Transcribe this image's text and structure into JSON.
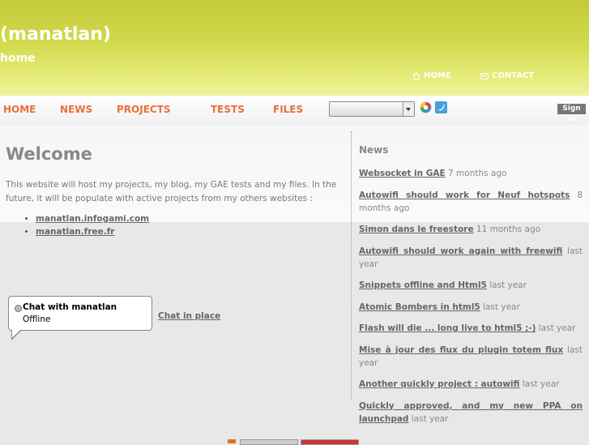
{
  "header": {
    "site_title": "(manatlan)",
    "subtitle": "home",
    "links": {
      "home": "HOME",
      "contact": "CONTACT"
    }
  },
  "nav": {
    "items": [
      "HOME",
      "NEWS",
      "PROJECTS",
      "TESTS",
      "FILES"
    ],
    "select_value": "",
    "sign_in": "Sign in",
    "icons": [
      "google-icon",
      "twitter-icon"
    ]
  },
  "main": {
    "title": "Welcome",
    "intro": "This website will host my projects, my blog, my GAE tests and my files. In the future, it will be populate with active projects from my others websites :",
    "projects": [
      "manatlan.infogami.com",
      "manatlan.free.fr"
    ]
  },
  "sidebar": {
    "title": "News",
    "news": [
      {
        "title": "Websocket in GAE",
        "time": "7 months ago"
      },
      {
        "title": "Autowifi should work for Neuf hotspots",
        "time": "8 months ago"
      },
      {
        "title": "Simon dans le freestore",
        "time": "11 months ago"
      },
      {
        "title": "Autowifi should work again with freewifi",
        "time": "last year"
      },
      {
        "title": "Snippets offline and Html5",
        "time": "last year"
      },
      {
        "title": "Atomic Bombers in html5",
        "time": "last year"
      },
      {
        "title": "Flash will die ... long live to html5 ;-)",
        "time": "last year"
      },
      {
        "title": "Mise à jour des flux du plugin totem flux",
        "time": "last year"
      },
      {
        "title": "Another quickly project : autowifi",
        "time": "last year"
      },
      {
        "title": "Quickly approved, and my new PPA on launchpad",
        "time": "last year"
      }
    ]
  },
  "chat": {
    "title": "Chat with manatlan",
    "status": "Offline",
    "in_place_link": "Chat in place"
  },
  "colors": {
    "header_green": "#cdd443",
    "nav_orange": "#e8703a",
    "link_gray": "#666666"
  }
}
